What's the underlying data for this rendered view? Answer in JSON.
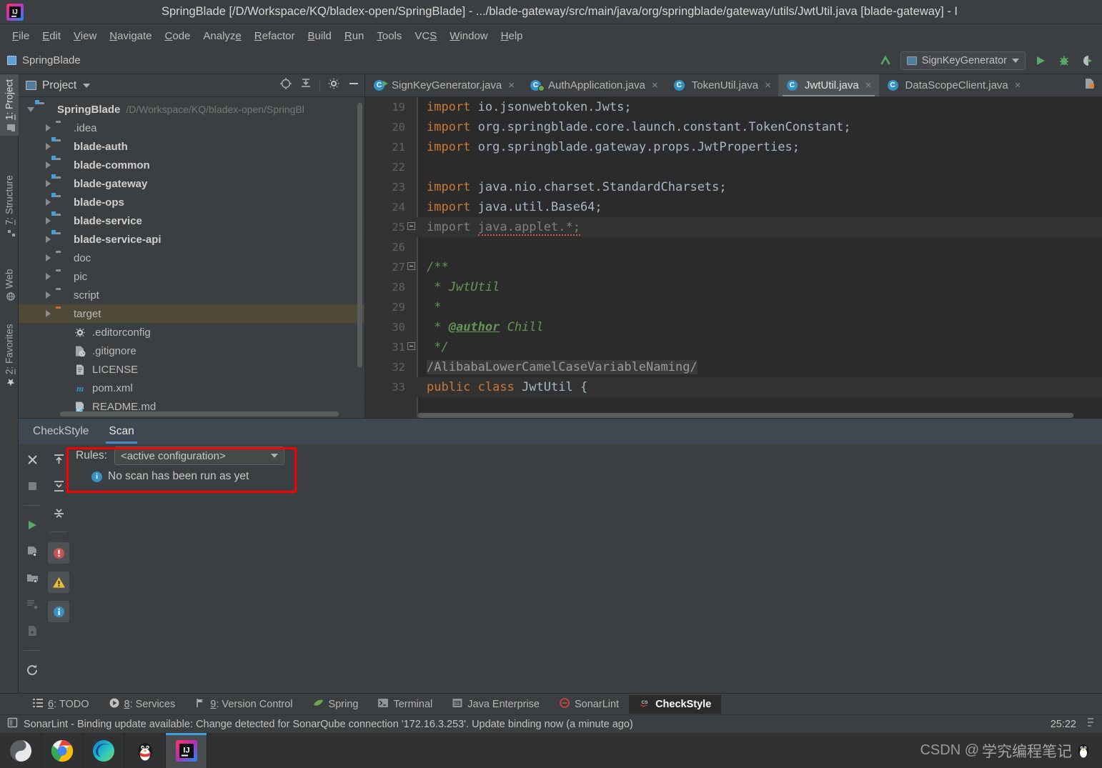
{
  "window": {
    "title": "SpringBlade [/D/Workspace/KQ/bladex-open/SpringBlade] - .../blade-gateway/src/main/java/org/springblade/gateway/utils/JwtUtil.java [blade-gateway] - I",
    "logo_icon": "intellij-idea-logo"
  },
  "menubar": {
    "items": [
      {
        "label": "File"
      },
      {
        "label": "Edit"
      },
      {
        "label": "View"
      },
      {
        "label": "Navigate"
      },
      {
        "label": "Code"
      },
      {
        "label": "Analyze"
      },
      {
        "label": "Refactor"
      },
      {
        "label": "Build"
      },
      {
        "label": "Run"
      },
      {
        "label": "Tools"
      },
      {
        "label": "VCS"
      },
      {
        "label": "Window"
      },
      {
        "label": "Help"
      }
    ]
  },
  "toolbar": {
    "project_label": "SpringBlade",
    "run_config": "SignKeyGenerator",
    "icons": [
      "back-arrow-icon",
      "run-icon",
      "debug-icon",
      "run-with-coverage-icon"
    ]
  },
  "left_strip": {
    "tabs": [
      {
        "label": "1: Project",
        "icon": "project-icon",
        "active": true
      },
      {
        "label": "7: Structure",
        "icon": "structure-icon",
        "active": false
      },
      {
        "label": "Web",
        "icon": "web-icon",
        "active": false
      },
      {
        "label": "2: Favorites",
        "icon": "star-icon",
        "active": false
      }
    ]
  },
  "project_panel": {
    "title": "Project",
    "actions": [
      "locate-icon",
      "collapse-all-icon",
      "settings-gear-icon",
      "hide-icon"
    ],
    "tree": [
      {
        "label": "SpringBlade",
        "path": "/D/Workspace/KQ/bladex-open/SpringBl",
        "indent": 0,
        "arrow": "open",
        "icon": "module-folder",
        "bold": true,
        "selected": false
      },
      {
        "label": ".idea",
        "path": "",
        "indent": 1,
        "arrow": "closed",
        "icon": "folder",
        "bold": false,
        "selected": false
      },
      {
        "label": "blade-auth",
        "path": "",
        "indent": 1,
        "arrow": "closed",
        "icon": "module-folder",
        "bold": true,
        "selected": false
      },
      {
        "label": "blade-common",
        "path": "",
        "indent": 1,
        "arrow": "closed",
        "icon": "module-folder",
        "bold": true,
        "selected": false
      },
      {
        "label": "blade-gateway",
        "path": "",
        "indent": 1,
        "arrow": "closed",
        "icon": "module-folder",
        "bold": true,
        "selected": false
      },
      {
        "label": "blade-ops",
        "path": "",
        "indent": 1,
        "arrow": "closed",
        "icon": "module-folder",
        "bold": true,
        "selected": false
      },
      {
        "label": "blade-service",
        "path": "",
        "indent": 1,
        "arrow": "closed",
        "icon": "module-folder",
        "bold": true,
        "selected": false
      },
      {
        "label": "blade-service-api",
        "path": "",
        "indent": 1,
        "arrow": "closed",
        "icon": "module-folder",
        "bold": true,
        "selected": false
      },
      {
        "label": "doc",
        "path": "",
        "indent": 1,
        "arrow": "closed",
        "icon": "folder",
        "bold": false,
        "selected": false
      },
      {
        "label": "pic",
        "path": "",
        "indent": 1,
        "arrow": "closed",
        "icon": "folder",
        "bold": false,
        "selected": false
      },
      {
        "label": "script",
        "path": "",
        "indent": 1,
        "arrow": "closed",
        "icon": "folder",
        "bold": false,
        "selected": false
      },
      {
        "label": "target",
        "path": "",
        "indent": 1,
        "arrow": "closed",
        "icon": "folder-excluded",
        "bold": false,
        "selected": true
      },
      {
        "label": ".editorconfig",
        "path": "",
        "indent": 2,
        "arrow": "none",
        "icon": "editorconfig-file",
        "bold": false,
        "selected": false
      },
      {
        "label": ".gitignore",
        "path": "",
        "indent": 2,
        "arrow": "none",
        "icon": "gitignore-file",
        "bold": false,
        "selected": false
      },
      {
        "label": "LICENSE",
        "path": "",
        "indent": 2,
        "arrow": "none",
        "icon": "text-file",
        "bold": false,
        "selected": false
      },
      {
        "label": "pom.xml",
        "path": "",
        "indent": 2,
        "arrow": "none",
        "icon": "maven-file",
        "bold": false,
        "selected": false
      },
      {
        "label": "README.md",
        "path": "",
        "indent": 2,
        "arrow": "none",
        "icon": "markdown-file",
        "bold": false,
        "selected": false
      }
    ]
  },
  "editor": {
    "tabs": [
      {
        "label": "SignKeyGenerator.java",
        "icon": "java-class-runnable-icon",
        "active": false
      },
      {
        "label": "AuthApplication.java",
        "icon": "spring-boot-class-icon",
        "active": false
      },
      {
        "label": "TokenUtil.java",
        "icon": "java-class-icon",
        "active": false
      },
      {
        "label": "JwtUtil.java",
        "icon": "java-class-icon",
        "active": true
      },
      {
        "label": "DataScopeClient.java",
        "icon": "java-class-icon",
        "active": false
      }
    ],
    "close_icon": "close-icon",
    "code": [
      {
        "num": "19",
        "fold": "",
        "segments": [
          {
            "t": "import ",
            "c": "kw"
          },
          {
            "t": "io.jsonwebtoken.Jwts;",
            "c": "id"
          }
        ],
        "highlight": false
      },
      {
        "num": "20",
        "fold": "",
        "segments": [
          {
            "t": "import ",
            "c": "kw"
          },
          {
            "t": "org.springblade.core.launch.constant.TokenConstant;",
            "c": "id"
          }
        ],
        "highlight": false
      },
      {
        "num": "21",
        "fold": "",
        "segments": [
          {
            "t": "import ",
            "c": "kw"
          },
          {
            "t": "org.springblade.gateway.props.JwtProperties;",
            "c": "id"
          }
        ],
        "highlight": false
      },
      {
        "num": "22",
        "fold": "",
        "segments": [],
        "highlight": false
      },
      {
        "num": "23",
        "fold": "",
        "segments": [
          {
            "t": "import ",
            "c": "kw"
          },
          {
            "t": "java.nio.charset.StandardCharsets;",
            "c": "id"
          }
        ],
        "highlight": false
      },
      {
        "num": "24",
        "fold": "",
        "segments": [
          {
            "t": "import ",
            "c": "kw"
          },
          {
            "t": "java.util.Base64;",
            "c": "id"
          }
        ],
        "highlight": false
      },
      {
        "num": "25",
        "fold": "minus",
        "segments": [
          {
            "t": "import ",
            "c": "gray"
          },
          {
            "t": "java.applet.*;",
            "c": "gray squiggle"
          }
        ],
        "highlight": true
      },
      {
        "num": "26",
        "fold": "",
        "segments": [],
        "highlight": false
      },
      {
        "num": "27",
        "fold": "minus",
        "segments": [
          {
            "t": "/**",
            "c": "cmt"
          }
        ],
        "highlight": false
      },
      {
        "num": "28",
        "fold": "",
        "segments": [
          {
            "t": " * JwtUtil",
            "c": "cmt"
          }
        ],
        "highlight": false
      },
      {
        "num": "29",
        "fold": "",
        "segments": [
          {
            "t": " *",
            "c": "cmt"
          }
        ],
        "highlight": false
      },
      {
        "num": "30",
        "fold": "",
        "segments": [
          {
            "t": " * ",
            "c": "cmt"
          },
          {
            "t": "@author",
            "c": "cmt-tag"
          },
          {
            "t": " Chill",
            "c": "cmt"
          }
        ],
        "highlight": false
      },
      {
        "num": "31",
        "fold": "minus",
        "segments": [
          {
            "t": " */",
            "c": "cmt"
          }
        ],
        "highlight": false
      },
      {
        "num": "32",
        "fold": "",
        "segments": [
          {
            "t": "/AlibabaLowerCamelCaseVariableNaming/",
            "c": "inspect-hl"
          }
        ],
        "highlight": false
      },
      {
        "num": "33",
        "fold": "",
        "segments": [
          {
            "t": "public class ",
            "c": "kw"
          },
          {
            "t": "JwtUtil {",
            "c": "id"
          }
        ],
        "highlight": true
      }
    ]
  },
  "checkstyle": {
    "tabs": [
      {
        "label": "CheckStyle",
        "active": false
      },
      {
        "label": "Scan",
        "active": true
      }
    ],
    "rules_label": "Rules:",
    "rules_value": "<active configuration>",
    "empty_message": "No scan has been run as yet",
    "left_tools": [
      "close-icon",
      "stop-icon",
      "run-icon",
      "scan-file-icon",
      "scan-module-icon",
      "scan-changed-icon",
      "scan-selection-icon",
      "refresh-icon"
    ],
    "left_tools2": [
      "expand-all-icon",
      "collapse-all-icon",
      "collapse-icon"
    ],
    "severity_filters": [
      {
        "name": "error-filter-icon",
        "color": "#c75450"
      },
      {
        "name": "warning-filter-icon",
        "color": "#e8bf36"
      },
      {
        "name": "info-filter-icon",
        "color": "#3592c4"
      }
    ],
    "highlight_color": "#fa0000"
  },
  "toolwindow_bar": {
    "items": [
      {
        "label": "6: TODO",
        "icon": "todo-icon",
        "active": false
      },
      {
        "label": "8: Services",
        "icon": "services-icon",
        "active": false
      },
      {
        "label": "9: Version Control",
        "icon": "version-control-icon",
        "active": false
      },
      {
        "label": "Spring",
        "icon": "spring-leaf-icon",
        "active": false
      },
      {
        "label": "Terminal",
        "icon": "terminal-icon",
        "active": false
      },
      {
        "label": "Java Enterprise",
        "icon": "java-enterprise-icon",
        "active": false
      },
      {
        "label": "SonarLint",
        "icon": "sonarlint-icon",
        "active": false
      },
      {
        "label": "CheckStyle",
        "icon": "checkstyle-icon",
        "active": true
      }
    ]
  },
  "statusbar": {
    "icon": "message-icon",
    "message": "SonarLint - Binding update available: Change detected for SonarQube connection '172.16.3.253'. Update binding now (a minute ago)",
    "caret_position": "25:22"
  },
  "taskbar": {
    "buttons": [
      {
        "name": "taskbar-app-yinyang",
        "active": false
      },
      {
        "name": "taskbar-app-chrome",
        "active": false
      },
      {
        "name": "taskbar-app-edge",
        "active": false
      },
      {
        "name": "taskbar-app-qq",
        "active": false
      },
      {
        "name": "taskbar-app-intellij",
        "active": true
      }
    ],
    "watermark_prefix": "CSDN @",
    "watermark_cn": "学究编程笔记"
  }
}
